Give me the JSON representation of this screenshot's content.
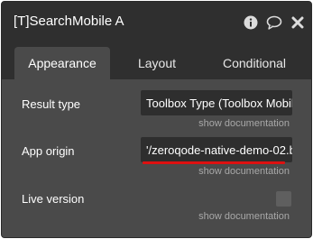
{
  "window": {
    "title": "[T]SearchMobile A"
  },
  "title_icons": [
    {
      "name": "info-icon"
    },
    {
      "name": "comment-icon"
    },
    {
      "name": "close-icon"
    }
  ],
  "tabs": [
    {
      "label": "Appearance",
      "active": true
    },
    {
      "label": "Layout",
      "active": false
    },
    {
      "label": "Conditional",
      "active": false
    }
  ],
  "fields": {
    "result_type": {
      "label": "Result type",
      "value": "Toolbox Type (Toolbox Mobil",
      "doc_link": "show documentation"
    },
    "app_origin": {
      "label": "App origin",
      "value": "'/zeroqode-native-demo-02.b",
      "doc_link": "show documentation"
    },
    "live_version": {
      "label": "Live version",
      "checked": false,
      "doc_link": "show documentation"
    }
  },
  "colors": {
    "accent_underline": "#dd1111",
    "panel_bg": "#4a4a4a",
    "titlebar_bg": "#2f2f2f"
  }
}
